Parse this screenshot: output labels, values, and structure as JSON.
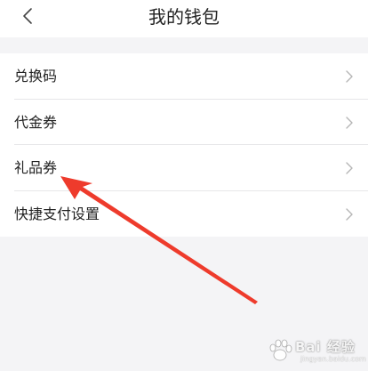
{
  "header": {
    "title": "我的钱包"
  },
  "menu": {
    "items": [
      {
        "label": "兑换码"
      },
      {
        "label": "代金券"
      },
      {
        "label": "礼品券"
      },
      {
        "label": "快捷支付设置"
      }
    ]
  },
  "annotation": {
    "arrow_color": "#ee3b2c",
    "points_to": "礼品券"
  },
  "watermark": {
    "text": "Bai 经验",
    "sub": "jingyan.baidu.com"
  }
}
